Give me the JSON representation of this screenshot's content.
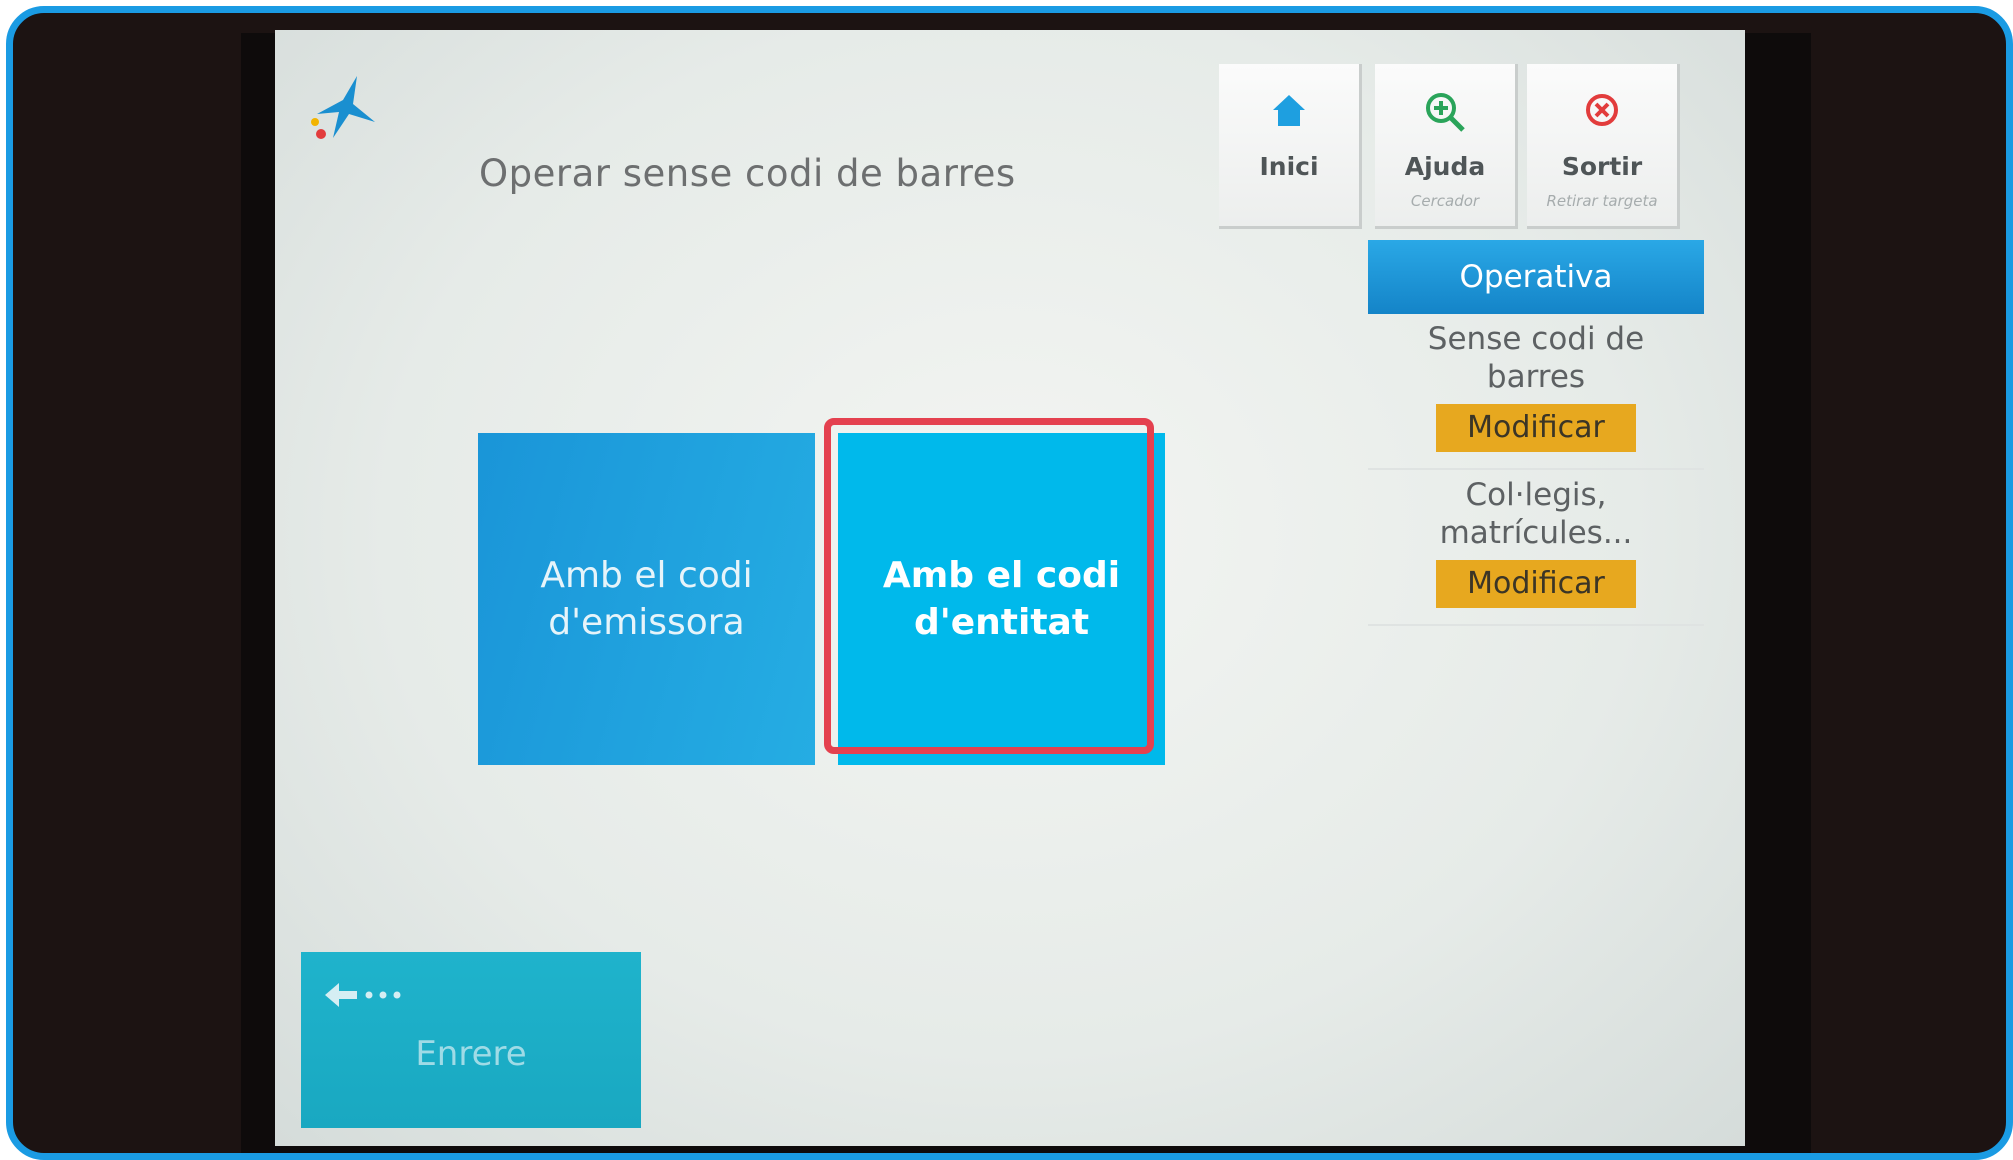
{
  "page": {
    "title": "Operar sense codi de barres"
  },
  "top_nav": [
    {
      "label": "Inici",
      "sub": "",
      "icon": "home-icon"
    },
    {
      "label": "Ajuda",
      "sub": "Cercador",
      "icon": "zoom-in-icon"
    },
    {
      "label": "Sortir",
      "sub": "Retirar targeta",
      "icon": "close-circle-icon"
    }
  ],
  "sidebar": {
    "header": "Operativa",
    "items": [
      {
        "text_line1": "Sense codi de",
        "text_line2": "barres",
        "button": "Modificar"
      },
      {
        "text_line1": "Col·legis,",
        "text_line2": "matrícules...",
        "button": "Modificar"
      }
    ]
  },
  "options": [
    {
      "line1": "Amb el codi",
      "line2": "d'emissora"
    },
    {
      "line1": "Amb el codi",
      "line2": "d'entitat"
    }
  ],
  "back": {
    "label": "Enrere",
    "icon": "back-arrow-icon"
  },
  "colors": {
    "accent_blue": "#1a9be3",
    "highlight_red": "#e4414f",
    "modify_orange": "#e7a81f",
    "tile_cyan": "#00b9eb"
  }
}
